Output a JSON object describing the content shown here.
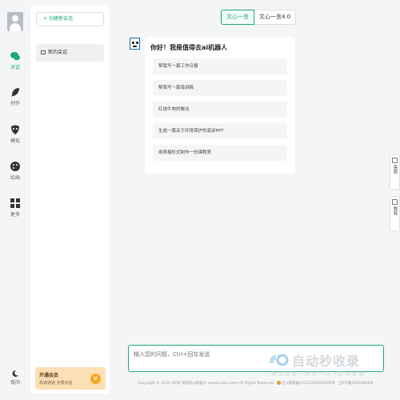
{
  "nav": {
    "items": [
      {
        "label": "对话",
        "icon": "chat-bubbles-icon",
        "active": true
      },
      {
        "label": "创作",
        "icon": "feather-icon",
        "active": false
      },
      {
        "label": "模拟",
        "icon": "mask-icon",
        "active": false
      },
      {
        "label": "绘画",
        "icon": "palette-icon",
        "active": false
      },
      {
        "label": "更多",
        "icon": "grid-icon",
        "active": false
      }
    ],
    "night_label": "夜间"
  },
  "sessions": {
    "new_chat_label": "创建新会话",
    "items": [
      {
        "label": "新的会话"
      }
    ]
  },
  "vip": {
    "title": "开通会员",
    "subtitle": "高速通道 无限对话",
    "badge": "V"
  },
  "model_tabs": [
    {
      "label": "文心一言",
      "active": true
    },
    {
      "label": "文心一言4.0",
      "active": false
    }
  ],
  "welcome": {
    "greeting": "你好！我是值得去ai机器人",
    "prompts": [
      "帮我写一篇工作日报",
      "帮我写一篇演讲稿",
      "红烧牛肉的做法",
      "生成一篇关于环境保护的演讲PPT",
      "用表格形式制作一份课程表"
    ]
  },
  "side_float": [
    {
      "label": "客服",
      "icon": "headset-icon"
    },
    {
      "label": "教程",
      "icon": "book-icon"
    }
  ],
  "input": {
    "placeholder": "输入您的问题，Ctrl+回车发送"
  },
  "footer": {
    "copyright": "Copyright © 2024-2030 值得去ai机器人 (www.zdqu.com) All Rights Reserved",
    "police": "辽公网安备21132202000109号",
    "icp": "辽ICP备13005889号"
  },
  "watermark": {
    "title": "自动秒收录",
    "subtitle": "放 上 链 接 → 来 访 一 次 → 自 动 收 录"
  },
  "colors": {
    "accent": "#1fa67a",
    "vip_bg": "#fbe0b5",
    "vip_badge": "#f5a623"
  }
}
